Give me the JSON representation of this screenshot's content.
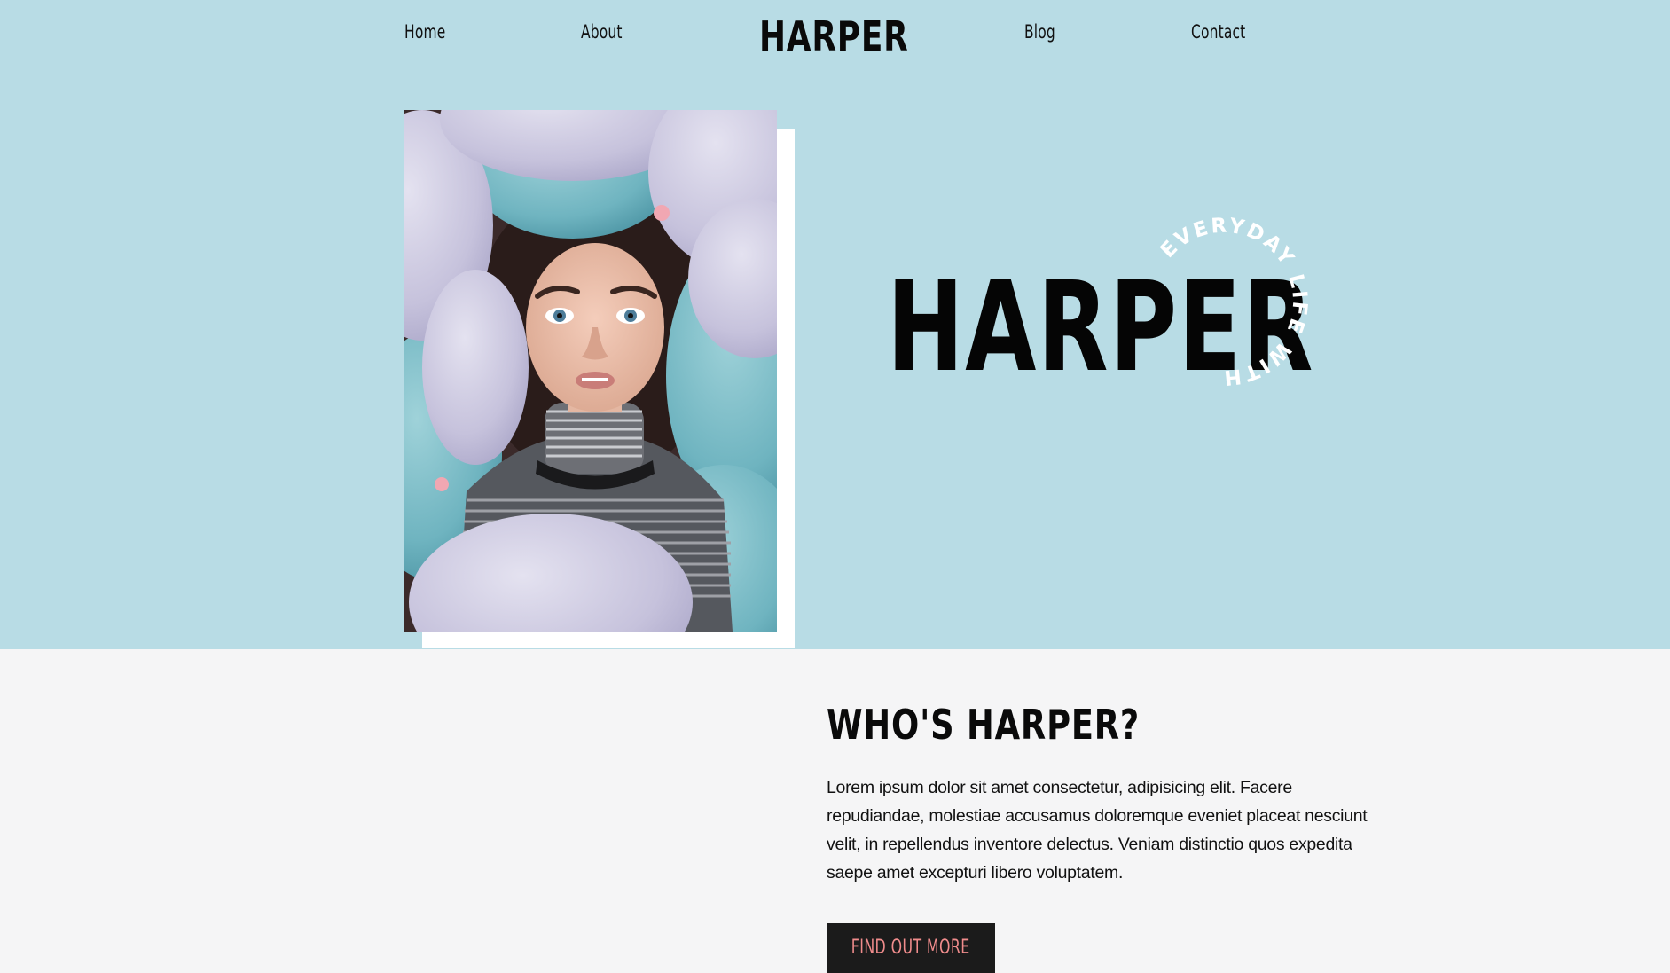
{
  "nav": {
    "home": "Home",
    "about": "About",
    "logo": "HARPER",
    "blog": "Blog",
    "contact": "Contact"
  },
  "hero": {
    "title": "HARPER",
    "arc_text": "EVERYDAY LIFE WITH",
    "photo_alt": "Woman surrounded by pastel balloons"
  },
  "about": {
    "heading": "WHO'S HARPER?",
    "body": "Lorem ipsum dolor sit amet consectetur, adipisicing elit. Facere repudiandae, molestiae accusamus doloremque eveniet placeat nesciunt velit, in repellendus inventore delectus. Veniam distinctio quos expedita saepe amet excepturi libero voluptatem.",
    "cta": "FIND OUT MORE"
  },
  "colors": {
    "hero_bg": "#b8dce5",
    "page_bg": "#f5f5f6",
    "cta_bg": "#1b1b1b",
    "cta_text": "#f08c8c"
  }
}
